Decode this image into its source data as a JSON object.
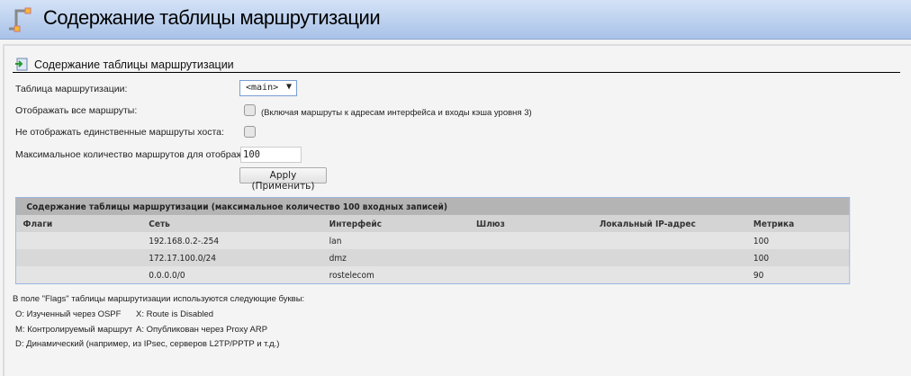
{
  "header": {
    "title": "Содержание таблицы маршрутизации"
  },
  "section": {
    "title": "Содержание таблицы маршрутизации"
  },
  "form": {
    "routing_table_label": "Таблица маршрутизации:",
    "routing_table_value": "<main>",
    "show_all_label": "Отображать все маршруты:",
    "show_all_note": "(Включая маршруты к адресам интерфейса и входы кэша уровня 3)",
    "hide_host_label": "Не отображать единственные маршруты хоста:",
    "max_routes_label": "Максимальное количество маршрутов для отображения:",
    "max_routes_value": "100",
    "apply_label": "Apply (Применить)"
  },
  "table": {
    "title": "Содержание таблицы маршрутизации (максимальное количество 100 входных записей)",
    "columns": [
      "Флаги",
      "Сеть",
      "Интерфейс",
      "Шлюз",
      "Локальный IP-адрес",
      "Метрика"
    ],
    "rows": [
      [
        "",
        "192.168.0.2-.254",
        "lan",
        "",
        "",
        "100"
      ],
      [
        "",
        "172.17.100.0/24",
        "dmz",
        "",
        "",
        "100"
      ],
      [
        "",
        "0.0.0.0/0",
        "rostelecom",
        "",
        "",
        "90"
      ]
    ]
  },
  "notes": {
    "intro": "В поле \"Flags\" таблицы маршрутизации используются следующие буквы:",
    "o": "O: Изученный через OSPF",
    "x": "X: Route is Disabled",
    "m": "M: Контролируемый маршрут",
    "a": "A: Опубликован через Proxy ARP",
    "d": "D: Динамический (например, из IPsec, серверов L2TP/PPTP и т.д.)"
  }
}
